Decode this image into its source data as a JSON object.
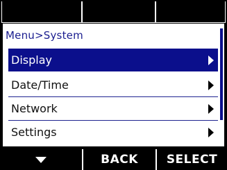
{
  "menu": {
    "breadcrumb": "Menu>System",
    "items": [
      {
        "label": "Display",
        "selected": true
      },
      {
        "label": "Date/Time",
        "selected": false
      },
      {
        "label": "Network",
        "selected": false
      },
      {
        "label": "Settings",
        "selected": false
      }
    ]
  },
  "softkeys": {
    "left_icon": "down-triangle-icon",
    "middle_label": "BACK",
    "right_label": "SELECT"
  },
  "colors": {
    "selection_bg": "#0b0f8c",
    "breadcrumb": "#1a1d8f",
    "background": "#000000",
    "panel": "#ffffff"
  }
}
